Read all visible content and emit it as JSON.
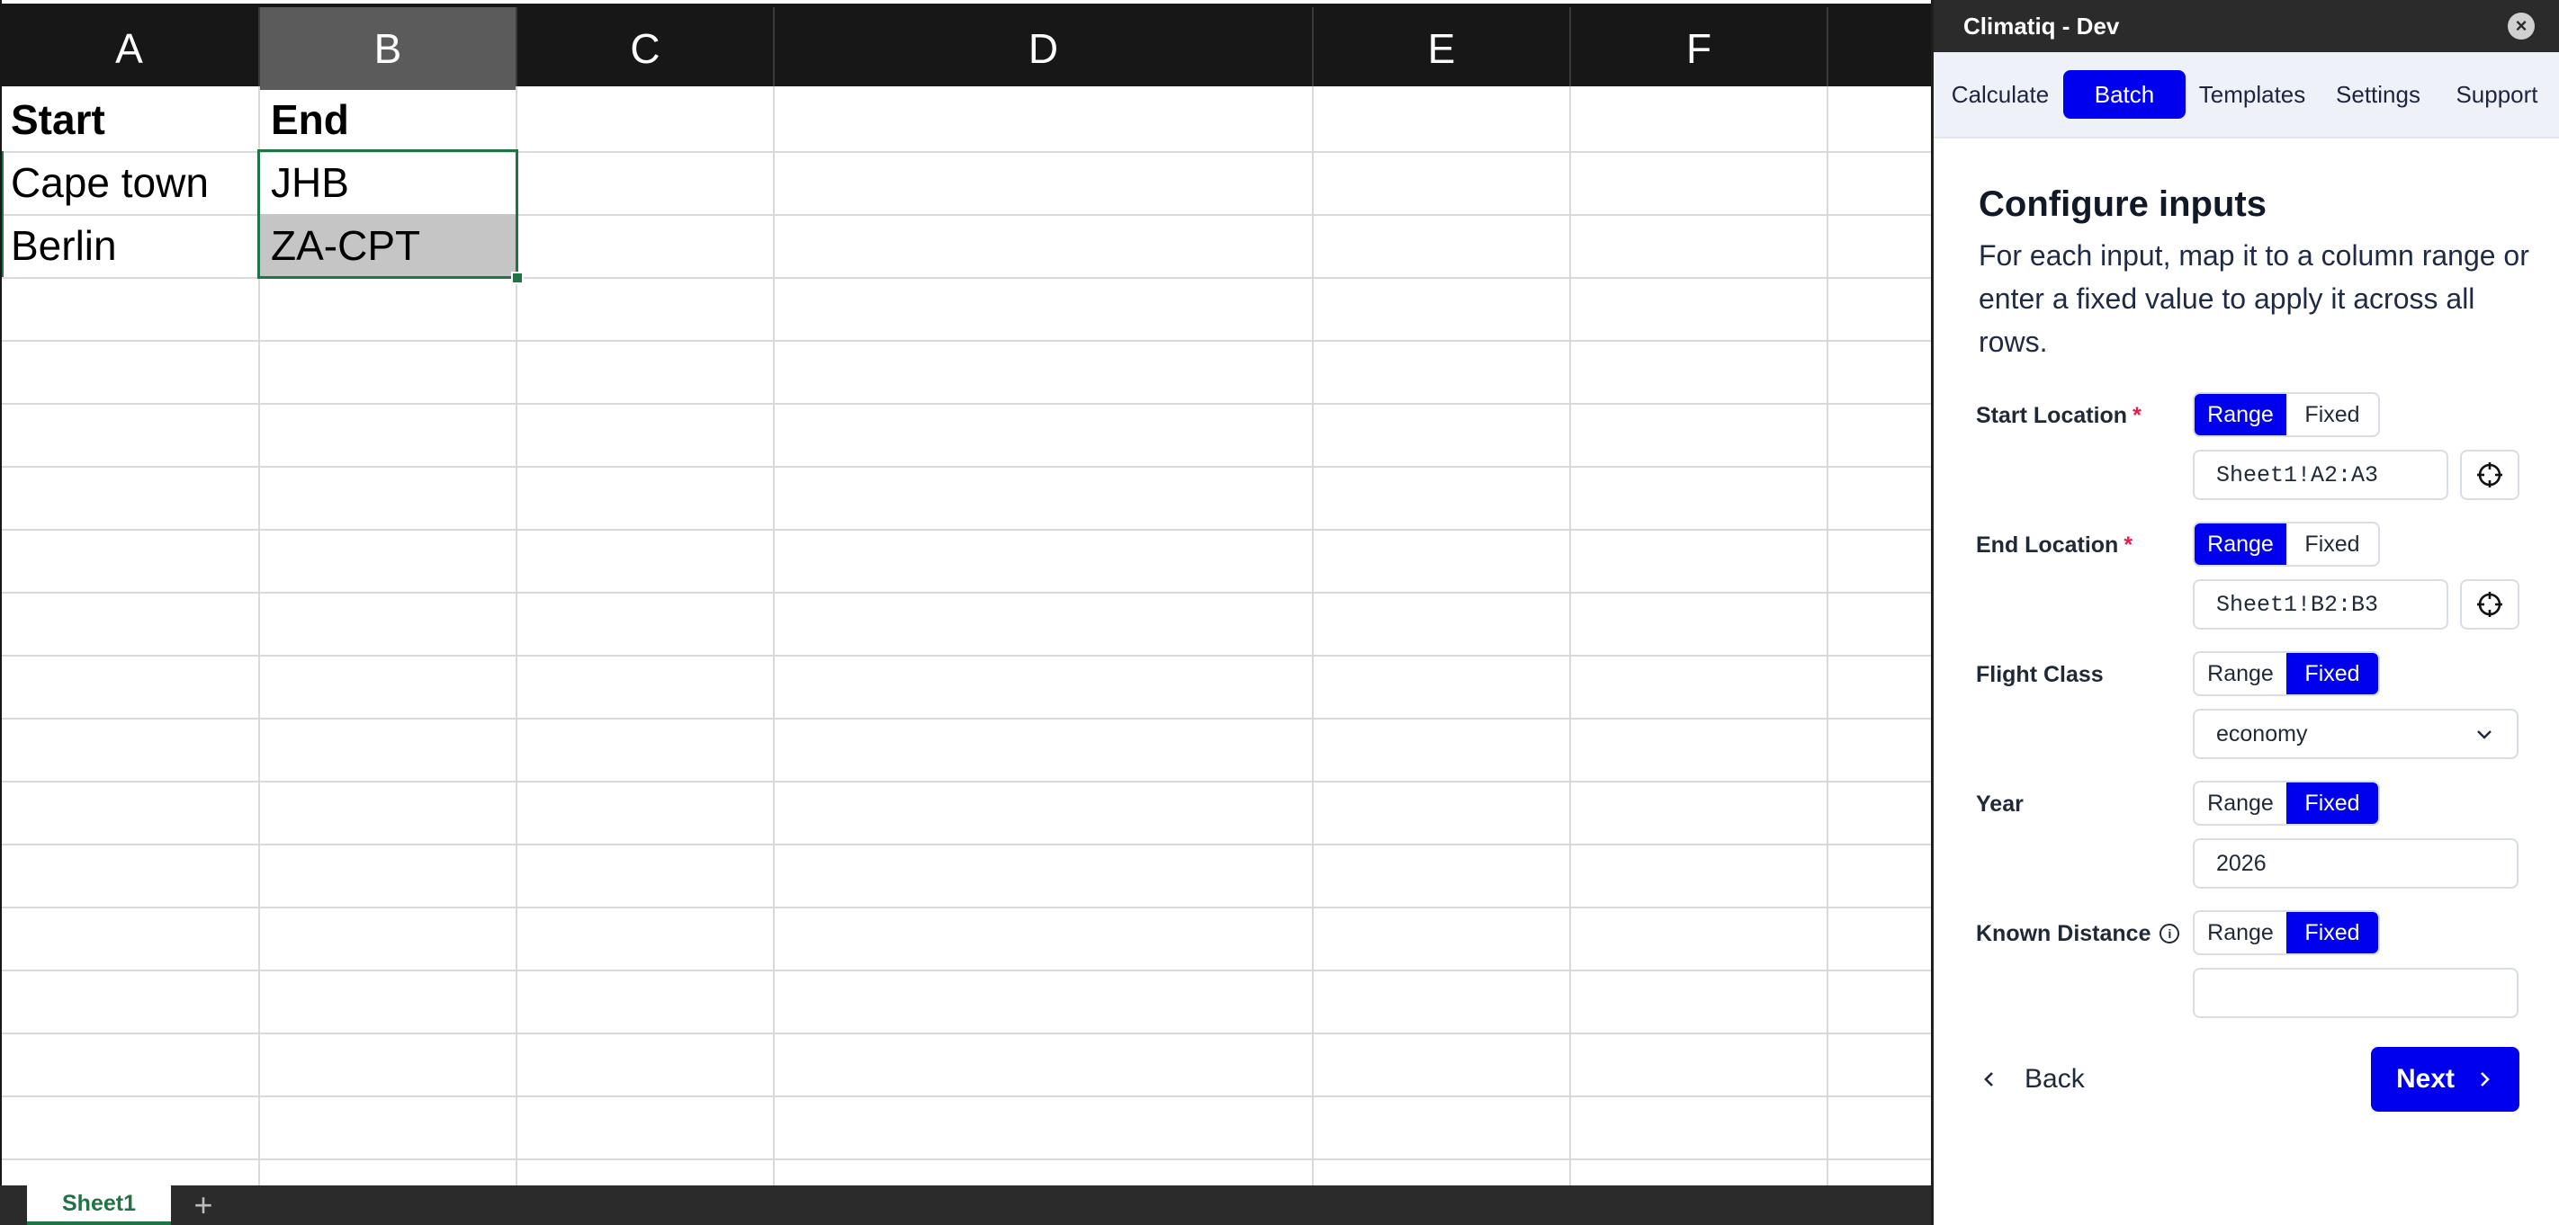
{
  "sheet": {
    "columns": [
      "A",
      "B",
      "C",
      "D",
      "E",
      "F"
    ],
    "cells": {
      "a1": "Start",
      "b1": "End",
      "a2": "Cape town",
      "b2": "JHB",
      "a3": "Berlin",
      "b3": "ZA-CPT"
    },
    "tab_name": "Sheet1",
    "add_sheet": "+"
  },
  "pane": {
    "title": "Climatiq - Dev",
    "close_icon": "×",
    "tabs": [
      "Calculate",
      "Batch",
      "Templates",
      "Settings",
      "Support"
    ],
    "active_tab": "Batch",
    "heading": "Configure inputs",
    "description": "For each input, map it to a column range or enter a fixed value to apply it across all rows.",
    "toggle_range": "Range",
    "toggle_fixed": "Fixed",
    "required_mark": "*",
    "fields": {
      "start_location": {
        "label": "Start Location",
        "mode": "Range",
        "value": "Sheet1!A2:A3"
      },
      "end_location": {
        "label": "End Location",
        "mode": "Range",
        "value": "Sheet1!B2:B3"
      },
      "flight_class": {
        "label": "Flight Class",
        "mode": "Fixed",
        "value": "economy"
      },
      "year": {
        "label": "Year",
        "mode": "Fixed",
        "value": "2026"
      },
      "known_distance": {
        "label": "Known Distance",
        "mode": "Fixed",
        "value": ""
      }
    },
    "back_label": "Back",
    "next_label": "Next",
    "colors": {
      "accent": "#0000ee",
      "required": "#e11d48",
      "excel_green": "#217346"
    },
    "icons": [
      "close-icon",
      "crosshair-icon",
      "chevron-down-icon",
      "chevron-left-icon",
      "chevron-right-icon",
      "info-icon"
    ]
  }
}
